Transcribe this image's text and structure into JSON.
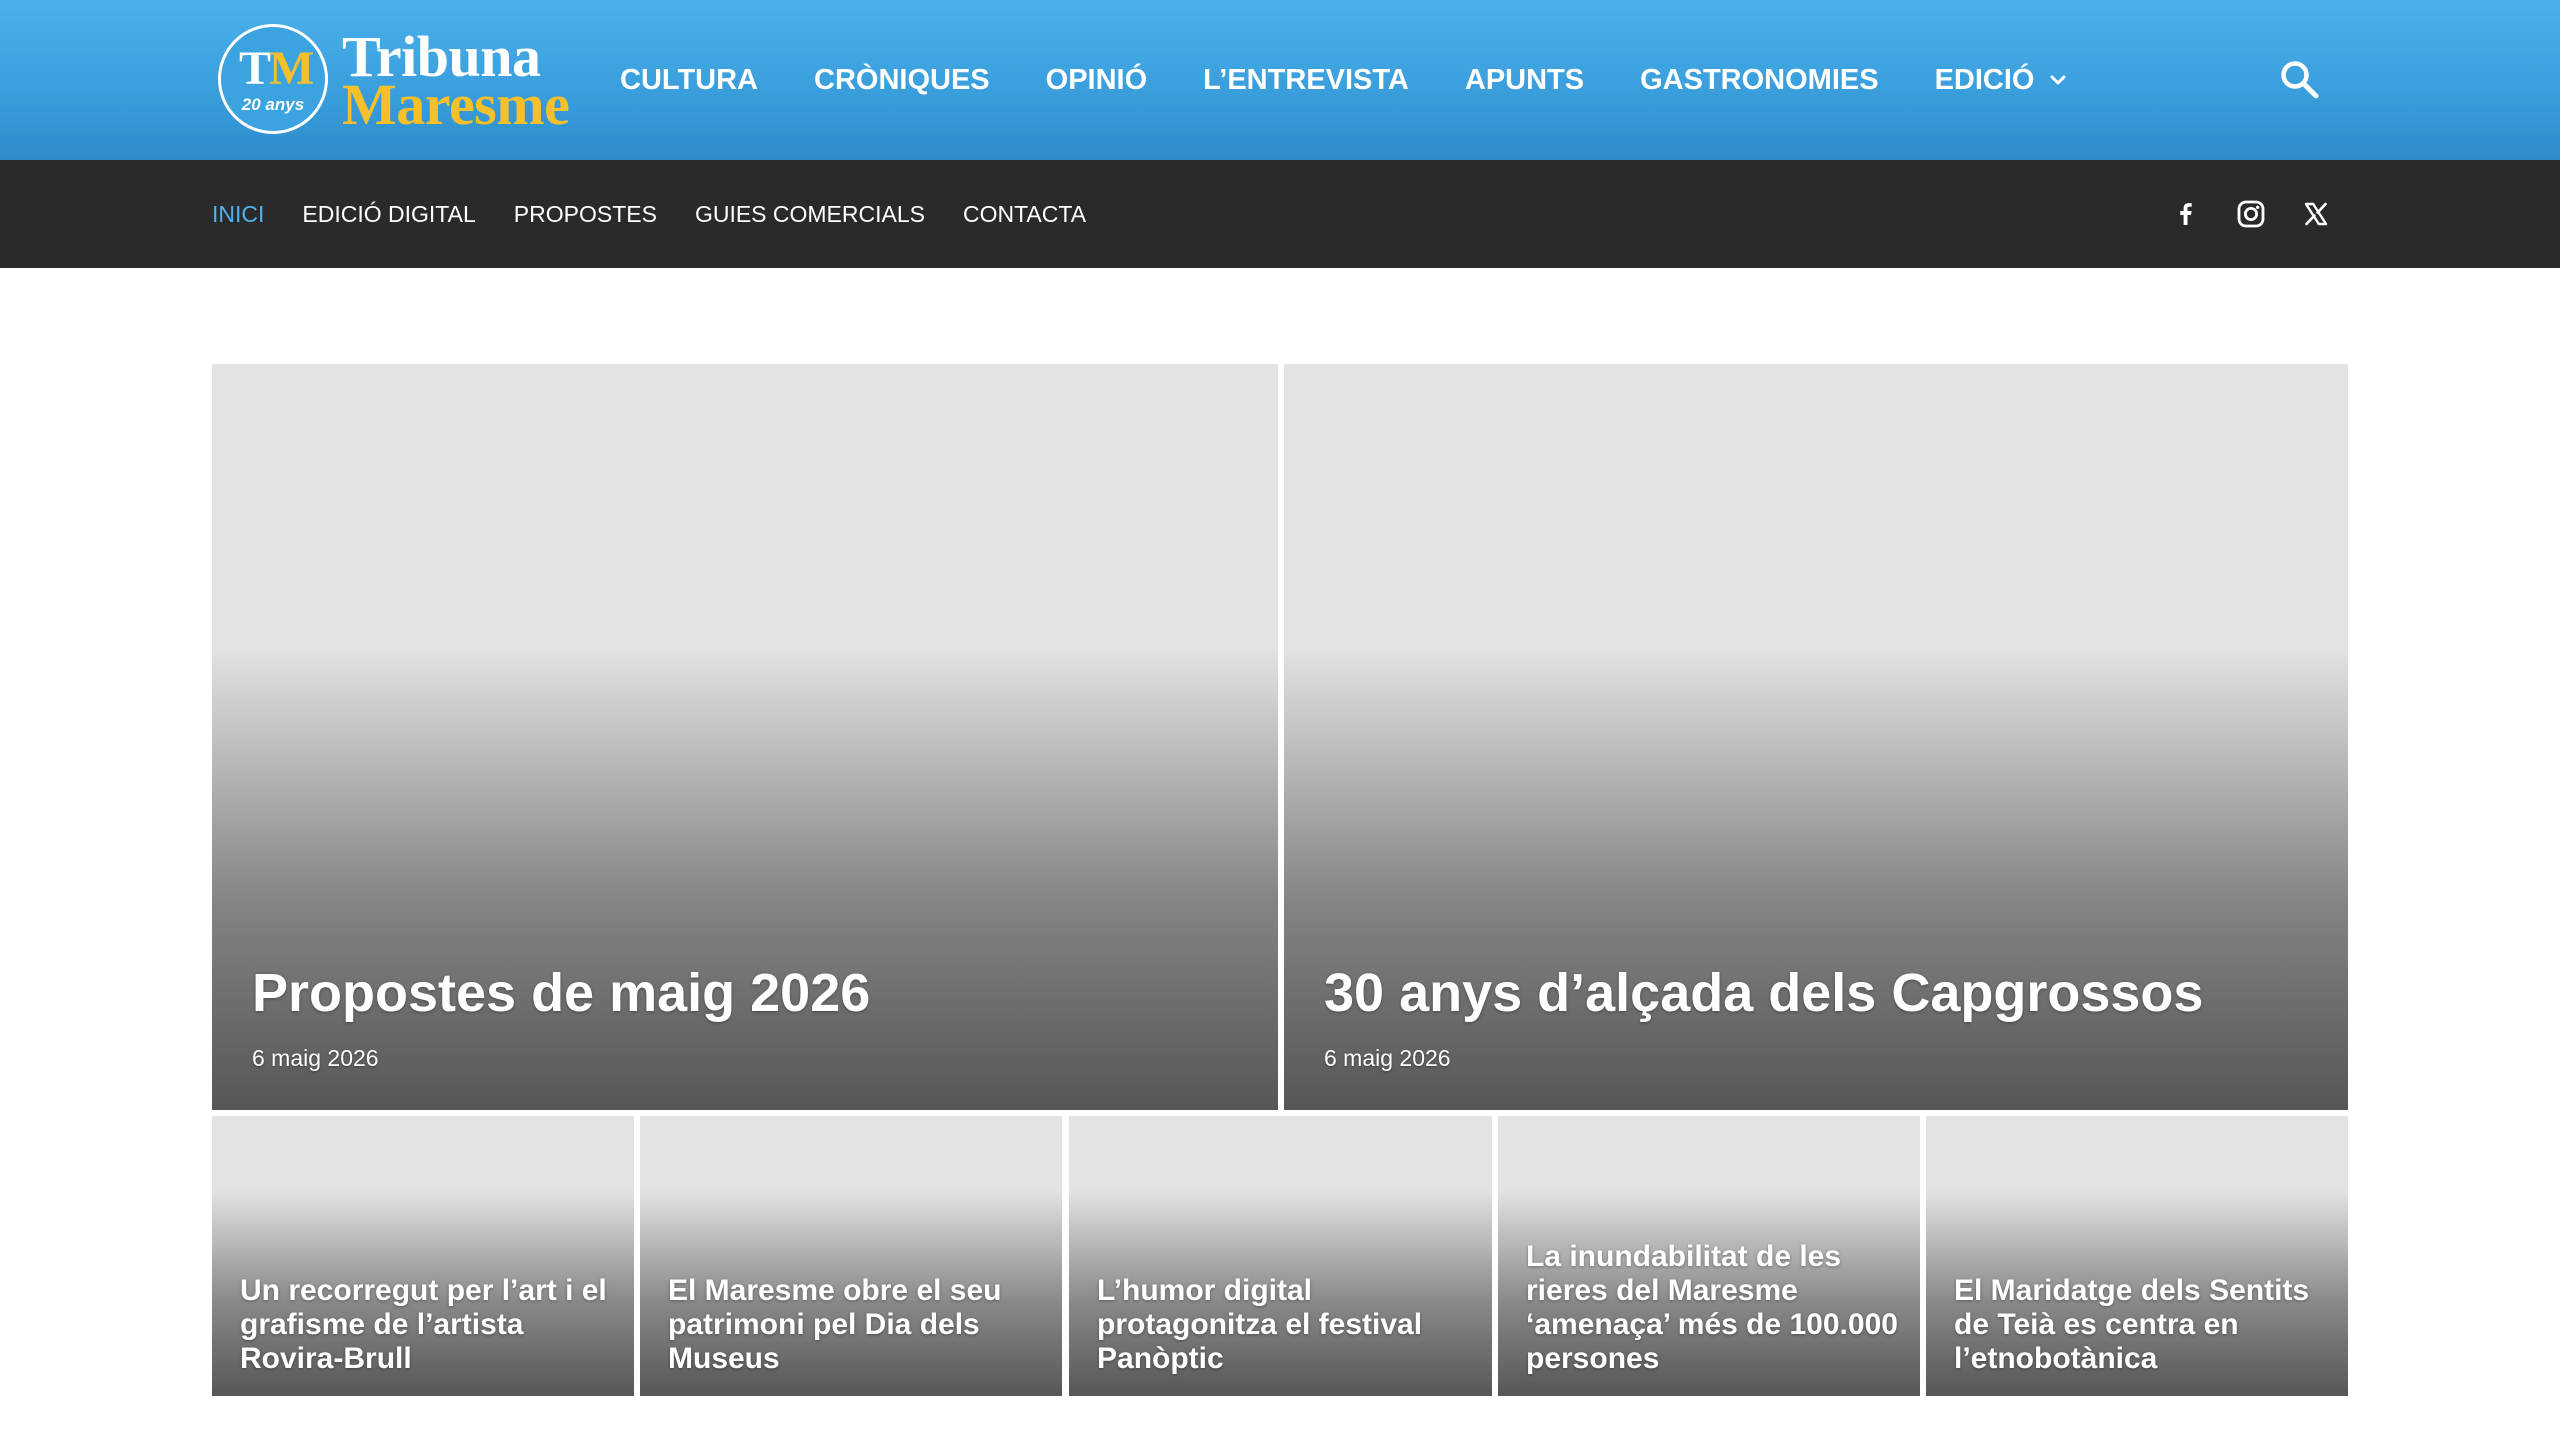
{
  "brand": {
    "logo_tm_t": "T",
    "logo_tm_m": "M",
    "logo_years": "20 anys",
    "logo_name_line1": "Tribuna",
    "logo_name_line2": "Maresme",
    "colors": {
      "header_blue": "#3ba3e0",
      "logo_yellow": "#f6c02a",
      "subbar_dark": "#2a2a2a",
      "active_link": "#4fb3ef"
    }
  },
  "main_nav": [
    {
      "label": "CULTURA"
    },
    {
      "label": "CRÒNIQUES"
    },
    {
      "label": "OPINIÓ"
    },
    {
      "label": "L’ENTREVISTA"
    },
    {
      "label": "APUNTS"
    },
    {
      "label": "GASTRONOMIES"
    },
    {
      "label": "EDICIÓ",
      "icon": "chevron-down-icon"
    }
  ],
  "search": {
    "icon": "search-icon"
  },
  "sub_nav": [
    {
      "label": "INICI",
      "active": true
    },
    {
      "label": "EDICIÓ DIGITAL"
    },
    {
      "label": "PROPOSTES"
    },
    {
      "label": "GUIES COMERCIALS"
    },
    {
      "label": "CONTACTA"
    }
  ],
  "social": [
    {
      "icon": "facebook-icon"
    },
    {
      "icon": "instagram-icon"
    },
    {
      "icon": "x-twitter-icon"
    }
  ],
  "featured": [
    {
      "title": "Propostes de maig 2026",
      "date": "6 maig 2026"
    },
    {
      "title": "30 anys d’alçada dels Capgrossos",
      "date": "6 maig 2026"
    }
  ],
  "articles": [
    {
      "title": "Un recorregut per l’art i el grafisme de l’artista Rovira-Brull"
    },
    {
      "title": "El Maresme obre el seu patrimoni pel Dia dels Museus"
    },
    {
      "title": "L’humor digital protagonitza el festival Panòptic"
    },
    {
      "title": "La inundabilitat de les rieres del Maresme ‘amenaça’ més de 100.000 persones"
    },
    {
      "title": "El Maridatge dels Sentits de Teià es centra en l’etnobotànica"
    }
  ]
}
